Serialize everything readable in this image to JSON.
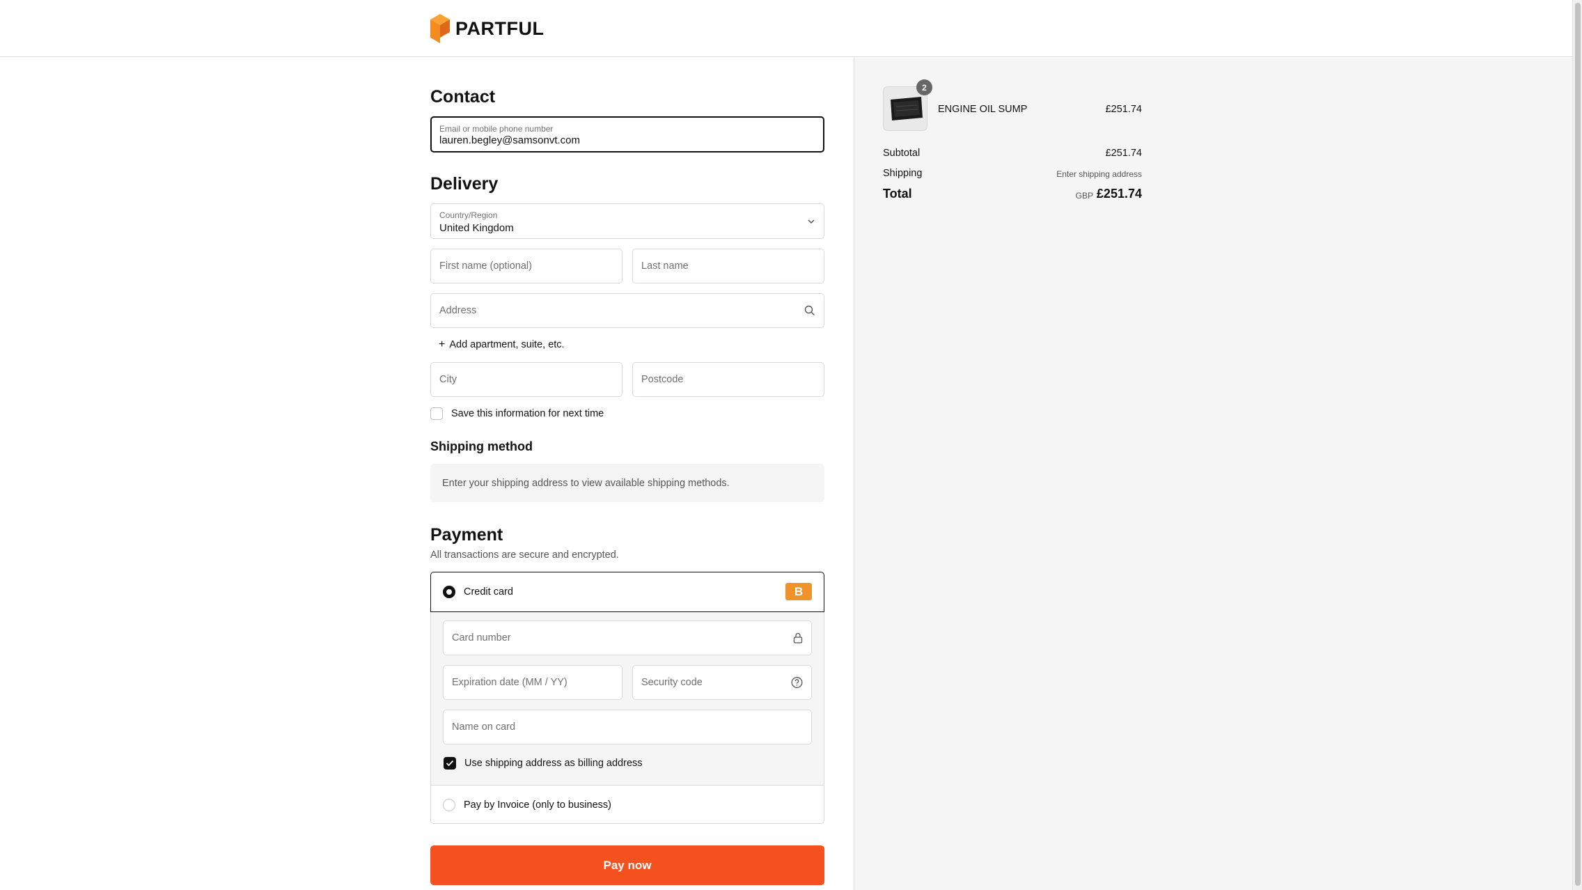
{
  "brand": {
    "name": "PARTFUL",
    "accent": "#f28c1f"
  },
  "contact": {
    "title": "Contact",
    "email_label": "Email or mobile phone number",
    "email_value": "lauren.begley@samsonvt.com"
  },
  "delivery": {
    "title": "Delivery",
    "country_label": "Country/Region",
    "country_value": "United Kingdom",
    "first_name_placeholder": "First name (optional)",
    "last_name_placeholder": "Last name",
    "address_placeholder": "Address",
    "add_apartment": "Add apartment, suite, etc.",
    "city_placeholder": "City",
    "postcode_placeholder": "Postcode",
    "save_info": "Save this information for next time",
    "save_info_checked": false
  },
  "shipping_method": {
    "title": "Shipping method",
    "message": "Enter your shipping address to view available shipping methods."
  },
  "payment": {
    "title": "Payment",
    "subtitle": "All transactions are secure and encrypted.",
    "credit_card_label": "Credit card",
    "credit_card_selected": true,
    "card_brand_letter": "B",
    "card_number_placeholder": "Card number",
    "expiry_placeholder": "Expiration date (MM / YY)",
    "security_code_placeholder": "Security code",
    "name_on_card_placeholder": "Name on card",
    "billing_same_label": "Use shipping address as billing address",
    "billing_same_checked": true,
    "invoice_label": "Pay by Invoice (only to business)",
    "invoice_selected": false,
    "pay_button": "Pay now",
    "pay_button_color": "#f4511e"
  },
  "summary": {
    "items": [
      {
        "name": "ENGINE OIL SUMP",
        "quantity": "2",
        "price": "£251.74"
      }
    ],
    "subtotal_label": "Subtotal",
    "subtotal_value": "£251.74",
    "shipping_label": "Shipping",
    "shipping_value": "Enter shipping address",
    "total_label": "Total",
    "currency": "GBP",
    "total_value": "£251.74"
  }
}
